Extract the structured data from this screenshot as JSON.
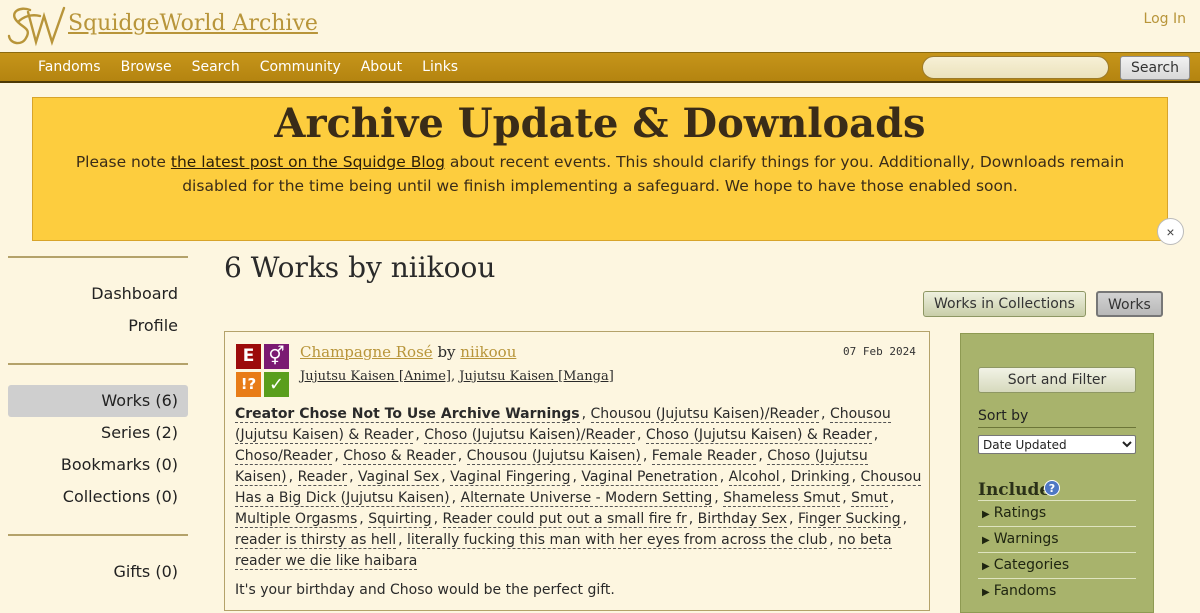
{
  "site": {
    "title": "SquidgeWorld Archive",
    "login": "Log In"
  },
  "nav": {
    "items": [
      "Fandoms",
      "Browse",
      "Search",
      "Community",
      "About",
      "Links"
    ],
    "search_button": "Search"
  },
  "banner": {
    "title": "Archive Update & Downloads",
    "text_before": "Please note ",
    "link": "the latest post on the Squidge Blog",
    "text_after": " about recent events. This should clarify things for you. Additionally, Downloads remain disabled for the time being until we finish implementing a safeguard. We hope to have those enabled soon.",
    "close": "×"
  },
  "sidebar": {
    "dashboard": "Dashboard",
    "profile": "Profile",
    "works": "Works (6)",
    "series": "Series (2)",
    "bookmarks": "Bookmarks (0)",
    "collections": "Collections (0)",
    "gifts": "Gifts (0)"
  },
  "main": {
    "heading": "6 Works by niikoou",
    "tabs": [
      "Works in Collections",
      "Works"
    ]
  },
  "work": {
    "title": "Champagne Rosé",
    "by": "by",
    "author": "niikoou",
    "date": "07 Feb 2024",
    "fandom1": "Jujutsu Kaisen [Anime]",
    "fandom2": "Jujutsu Kaisen [Manga]",
    "required_tags": {
      "rating": "E",
      "category": "⚥",
      "warning": "!?",
      "complete": "✓"
    },
    "warning_tag": "Creator Chose Not To Use Archive Warnings",
    "tags": [
      "Chousou (Jujutsu Kaisen)/Reader",
      "Chousou (Jujutsu Kaisen) & Reader",
      "Choso (Jujutsu Kaisen)/Reader",
      "Choso (Jujutsu Kaisen) & Reader",
      "Choso/Reader",
      "Choso & Reader",
      "Chousou (Jujutsu Kaisen)",
      "Female Reader",
      "Choso (Jujutsu Kaisen)",
      "Reader",
      "Vaginal Sex",
      "Vaginal Fingering",
      "Vaginal Penetration",
      "Alcohol",
      "Drinking",
      "Chousou Has a Big Dick (Jujutsu Kaisen)",
      "Alternate Universe - Modern Setting",
      "Shameless Smut",
      "Smut",
      "Multiple Orgasms",
      "Squirting",
      "Reader could put out a small fire fr",
      "Birthday Sex",
      "Finger Sucking",
      "reader is thirsty as hell",
      "literally fucking this man with her eyes from across the club",
      "no beta reader we die like haibara"
    ],
    "summary": "It's your birthday and Choso would be the perfect gift."
  },
  "filters": {
    "button": "Sort and Filter",
    "sort_label": "Sort by",
    "sort_value": "Date Updated",
    "include": "Include",
    "help": "?",
    "include_items": [
      "Ratings",
      "Warnings",
      "Categories",
      "Fandoms"
    ]
  },
  "colors": {
    "rating_explicit": "#9c0b0b",
    "category_multi": "#7b1a72",
    "warning_choose_not": "#e87c17",
    "complete": "#5a9e1c",
    "nav_gold": "#c6951a",
    "banner_yellow": "#fdcd3e",
    "filter_green": "#a8b36c"
  },
  "icons": [
    "squidgeworld-logo-icon",
    "close-icon",
    "help-icon",
    "triangle-right-icon"
  ]
}
